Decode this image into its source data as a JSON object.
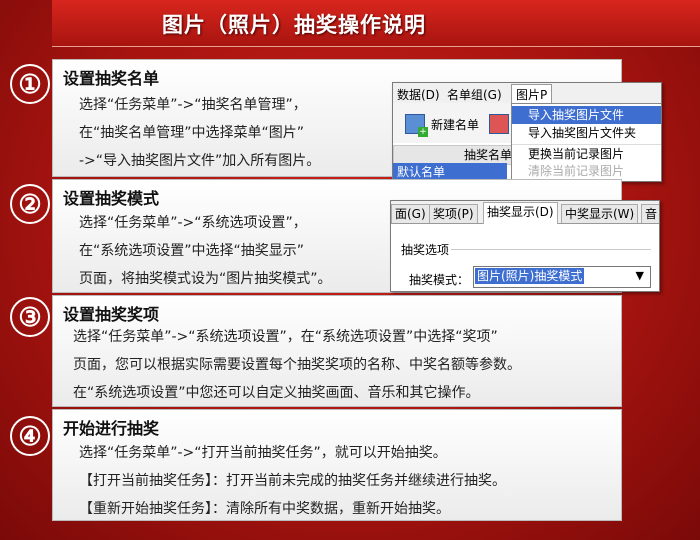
{
  "title": "图片（照片）抽奖操作说明",
  "sections": [
    {
      "number": "①",
      "heading": "设置抽奖名单",
      "lines": [
        "选择“任务菜单”->“抽奖名单管理”，",
        "在“抽奖名单管理”中选择菜单“图片”",
        "->“导入抽奖图片文件”加入所有图片。"
      ]
    },
    {
      "number": "②",
      "heading": "设置抽奖模式",
      "lines": [
        "选择“任务菜单”->“系统选项设置”，",
        "在“系统选项设置”中选择“抽奖显示”",
        "页面，将抽奖模式设为“图片抽奖模式”。"
      ]
    },
    {
      "number": "③",
      "heading": "设置抽奖奖项",
      "lines": [
        "选择“任务菜单”->“系统选项设置”，在“系统选项设置”中选择“奖项”",
        "页面，您可以根据实际需要设置每个抽奖奖项的名称、中奖名额等参数。",
        "在“系统选项设置”中您还可以自定义抽奖画面、音乐和其它操作。"
      ]
    },
    {
      "number": "④",
      "heading": "开始进行抽奖",
      "lines": [
        "选择“任务菜单”->“打开当前抽奖任务”，就可以开始抽奖。",
        "【打开当前抽奖任务】：打开当前未完成的抽奖任务并继续进行抽奖。",
        "【重新开始抽奖任务】：清除所有中奖数据，重新开始抽奖。"
      ]
    }
  ],
  "screenshot1": {
    "menu": [
      "数据(D)",
      "名单组(G)",
      "图片P"
    ],
    "new_list_button": "新建名单",
    "column_header": "抽奖名单",
    "default_list": "默认名单",
    "dropdown_items": [
      "导入抽奖图片文件",
      "导入抽奖图片文件夹",
      "更换当前记录图片",
      "清除当前记录图片"
    ]
  },
  "screenshot2": {
    "tabs": [
      "面(G)",
      "奖项(P)",
      "抽奖显示(D)",
      "中奖显示(W)",
      "音"
    ],
    "active_tab": 2,
    "group_label": "抽奖选项",
    "mode_label": "抽奖模式：",
    "mode_value": "图片(照片)抽奖模式",
    "arrow_glyph": "▼"
  }
}
